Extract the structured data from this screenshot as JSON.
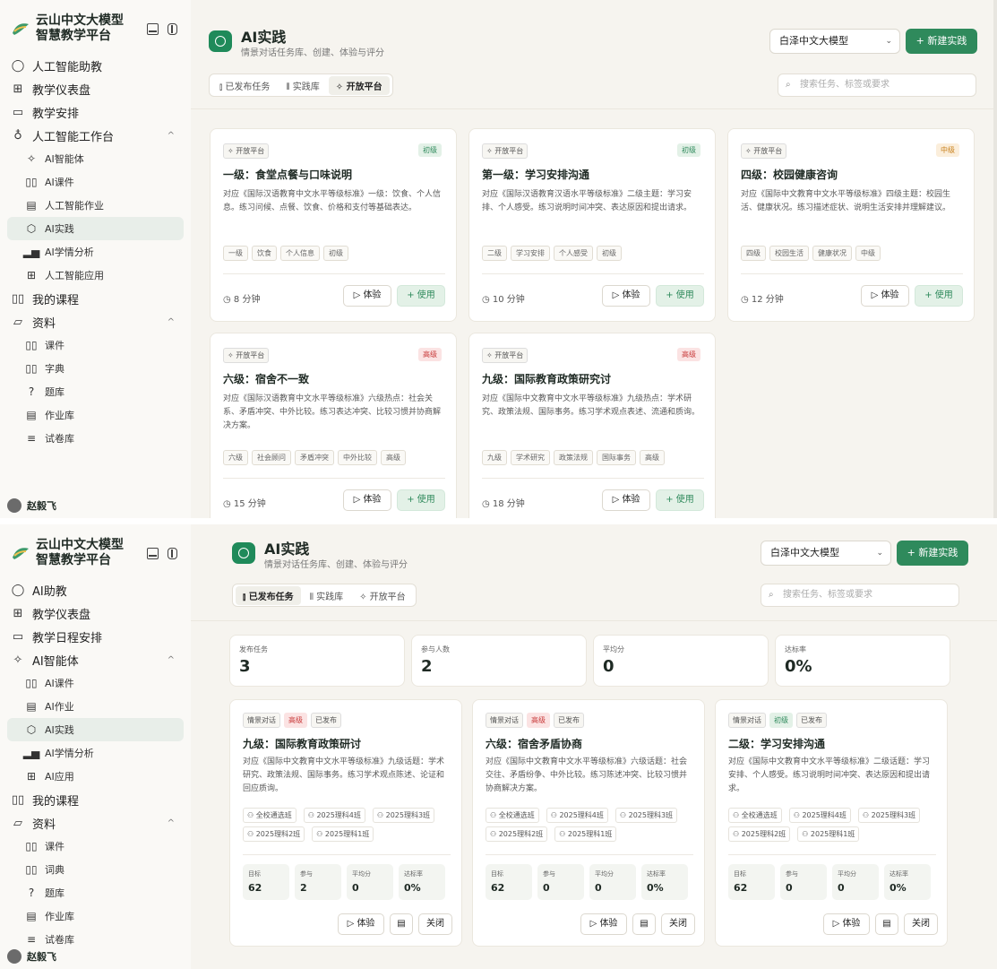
{
  "frame1": {
    "brand": {
      "line1": "云山中文大模型",
      "line2": "智慧教学平台"
    },
    "nav": [
      {
        "label": "人工智能助教",
        "icon": "chat-icon"
      },
      {
        "label": "教学仪表盘",
        "icon": "grid-icon"
      },
      {
        "label": "教学安排",
        "icon": "calendar-icon"
      },
      {
        "label": "人工智能工作台",
        "icon": "bulb-icon",
        "expanded": true
      }
    ],
    "sub": [
      {
        "label": "AI智能体",
        "icon": "sparkle-icon"
      },
      {
        "label": "AI课件",
        "icon": "book-icon"
      },
      {
        "label": "人工智能作业",
        "icon": "file-icon"
      },
      {
        "label": "AI实践",
        "icon": "hexagon-icon",
        "active": true
      },
      {
        "label": "AI学情分析",
        "icon": "bars-icon"
      },
      {
        "label": "人工智能应用",
        "icon": "apps-icon"
      }
    ],
    "nav2": [
      {
        "label": "我的课程",
        "icon": "book-icon"
      },
      {
        "label": "资料",
        "icon": "folder-icon",
        "expanded": true
      }
    ],
    "sub2": [
      {
        "label": "课件",
        "icon": "book-icon"
      },
      {
        "label": "字典",
        "icon": "book-icon"
      },
      {
        "label": "题库",
        "icon": "question-icon"
      },
      {
        "label": "作业库",
        "icon": "file-icon"
      },
      {
        "label": "试卷库",
        "icon": "stack-icon"
      }
    ],
    "user": "赵毅飞",
    "header": {
      "title": "AI实践",
      "subtitle": "情景对话任务库、创建、体验与评分",
      "model": "白泽中文大模型",
      "new_button": "+ 新建实践",
      "search_placeholder": "搜索任务、标签或要求"
    },
    "tabs": [
      "已发布任务",
      "实践库",
      "开放平台"
    ],
    "active_tab": 2,
    "cards": [
      {
        "source": "开放平台",
        "level": "初级",
        "level_class": "low",
        "title": "一级：食堂点餐与口味说明",
        "desc": "对应《国际汉语教育中文水平等级标准》一级：饮食、个人信息。练习问候、点餐、饮食、价格和支付等基础表达。",
        "tags": [
          "一级",
          "饮食",
          "个人信息",
          "初级"
        ],
        "duration": "8 分钟"
      },
      {
        "source": "开放平台",
        "level": "初级",
        "level_class": "low",
        "title": "第一级：学习安排沟通",
        "desc": "对应《国际汉语教育汉语水平等级标准》二级主题：学习安排、个人感受。练习说明时间冲突、表达原因和提出请求。",
        "tags": [
          "二级",
          "学习安排",
          "个人感受",
          "初级"
        ],
        "duration": "10 分钟"
      },
      {
        "source": "开放平台",
        "level": "中级",
        "level_class": "mid",
        "title": "四级：校园健康咨询",
        "desc": "对应《国际中文教育中文水平等级标准》四级主题：校园生活、健康状况。练习描述症状、说明生活安排并理解建议。",
        "tags": [
          "四级",
          "校园生活",
          "健康状况",
          "中级"
        ],
        "duration": "12 分钟"
      },
      {
        "source": "开放平台",
        "level": "高级",
        "level_class": "high",
        "title": "六级：宿舍不一致",
        "desc": "对应《国际汉语教育中文水平等级标准》六级热点：社会关系、矛盾冲突、中外比较。练习表达冲突、比较习惯并协商解决方案。",
        "tags": [
          "六级",
          "社会顾问",
          "矛盾冲突",
          "中外比较",
          "高级"
        ],
        "duration": "15 分钟"
      },
      {
        "source": "开放平台",
        "level": "高级",
        "level_class": "high",
        "title": "九级：国际教育政策研究讨",
        "desc": "对应《国际中文教育中文水平等级标准》九级热点：学术研究、政策法规、国际事务。练习学术观点表述、流通和质询。",
        "tags": [
          "九级",
          "学术研究",
          "政策法规",
          "国际事务",
          "高级"
        ],
        "duration": "18 分钟"
      }
    ],
    "try_label": "体验",
    "use_label": "+ 使用"
  },
  "frame2": {
    "brand": {
      "line1": "云山中文大模型",
      "line2": "智慧教学平台"
    },
    "nav": [
      {
        "label": "AI助教",
        "icon": "chat-icon"
      },
      {
        "label": "教学仪表盘",
        "icon": "grid-icon"
      },
      {
        "label": "教学日程安排",
        "icon": "calendar-icon"
      },
      {
        "label": "AI智能体",
        "icon": "sparkle-icon",
        "expanded": true
      }
    ],
    "sub": [
      {
        "label": "AI课件",
        "icon": "book-icon"
      },
      {
        "label": "AI作业",
        "icon": "file-icon"
      },
      {
        "label": "AI实践",
        "icon": "hexagon-icon",
        "active": true
      },
      {
        "label": "AI学情分析",
        "icon": "bars-icon"
      },
      {
        "label": "AI应用",
        "icon": "apps-icon"
      }
    ],
    "nav2": [
      {
        "label": "我的课程",
        "icon": "book-icon"
      },
      {
        "label": "资料",
        "icon": "folder-icon",
        "expanded": true
      }
    ],
    "sub2": [
      {
        "label": "课件",
        "icon": "book-icon"
      },
      {
        "label": "词典",
        "icon": "book-icon"
      },
      {
        "label": "题库",
        "icon": "question-icon"
      },
      {
        "label": "作业库",
        "icon": "file-icon"
      },
      {
        "label": "试卷库",
        "icon": "stack-icon"
      }
    ],
    "user": "赵毅飞",
    "header": {
      "title": "AI实践",
      "subtitle": "情景对话任务库、创建、体验与评分",
      "model": "白泽中文大模型",
      "new_button": "+ 新建实践",
      "search_placeholder": "搜索任务、标签或要求"
    },
    "tabs": [
      "已发布任务",
      "实践库",
      "开放平台"
    ],
    "active_tab": 0,
    "stats": [
      {
        "label": "发布任务",
        "value": "3"
      },
      {
        "label": "参与人数",
        "value": "2"
      },
      {
        "label": "平均分",
        "value": "0"
      },
      {
        "label": "达标率",
        "value": "0%"
      }
    ],
    "cards": [
      {
        "type": "情景对话",
        "level": "高级",
        "level_class": "high",
        "status": "已发布",
        "title": "九级：国际教育政策研讨",
        "desc": "对应《国际中文教育中文水平等级标准》九级话题：学术研究、政策法规、国际事务。练习学术观点陈述、论证和回应质询。",
        "classes": [
          "全校通选班",
          "2025理科4班",
          "2025理科3班",
          "2025理科2班",
          "2025理科1班"
        ],
        "metrics": [
          {
            "label": "目标",
            "value": "62"
          },
          {
            "label": "参与",
            "value": "2"
          },
          {
            "label": "平均分",
            "value": "0"
          },
          {
            "label": "达标率",
            "value": "0%"
          }
        ]
      },
      {
        "type": "情景对话",
        "level": "高级",
        "level_class": "high",
        "status": "已发布",
        "title": "六级：宿舍矛盾协商",
        "desc": "对应《国际中文教育中文水平等级标准》六级话题：社会交往、矛盾纷争、中外比较。练习陈述冲突、比较习惯并协商解决方案。",
        "classes": [
          "全校通选班",
          "2025理科4班",
          "2025理科3班",
          "2025理科2班",
          "2025理科1班"
        ],
        "metrics": [
          {
            "label": "目标",
            "value": "62"
          },
          {
            "label": "参与",
            "value": "0"
          },
          {
            "label": "平均分",
            "value": "0"
          },
          {
            "label": "达标率",
            "value": "0%"
          }
        ]
      },
      {
        "type": "情景对话",
        "level": "初级",
        "level_class": "low",
        "status": "已发布",
        "title": "二级：学习安排沟通",
        "desc": "对应《国际中文教育中文水平等级标准》二级话题：学习安排、个人感受。练习说明时间冲突、表达原因和提出请求。",
        "classes": [
          "全校通选班",
          "2025理科4班",
          "2025理科3班",
          "2025理科2班",
          "2025理科1班"
        ],
        "metrics": [
          {
            "label": "目标",
            "value": "62"
          },
          {
            "label": "参与",
            "value": "0"
          },
          {
            "label": "平均分",
            "value": "0"
          },
          {
            "label": "达标率",
            "value": "0%"
          }
        ]
      }
    ],
    "try_label": "体验",
    "close_label": "关闭"
  },
  "colors": {
    "accent": "#2f8a5c",
    "active_nav": "#e8eee9",
    "high": "#c93b3b",
    "mid": "#c98320",
    "low": "#2f8a5c"
  }
}
